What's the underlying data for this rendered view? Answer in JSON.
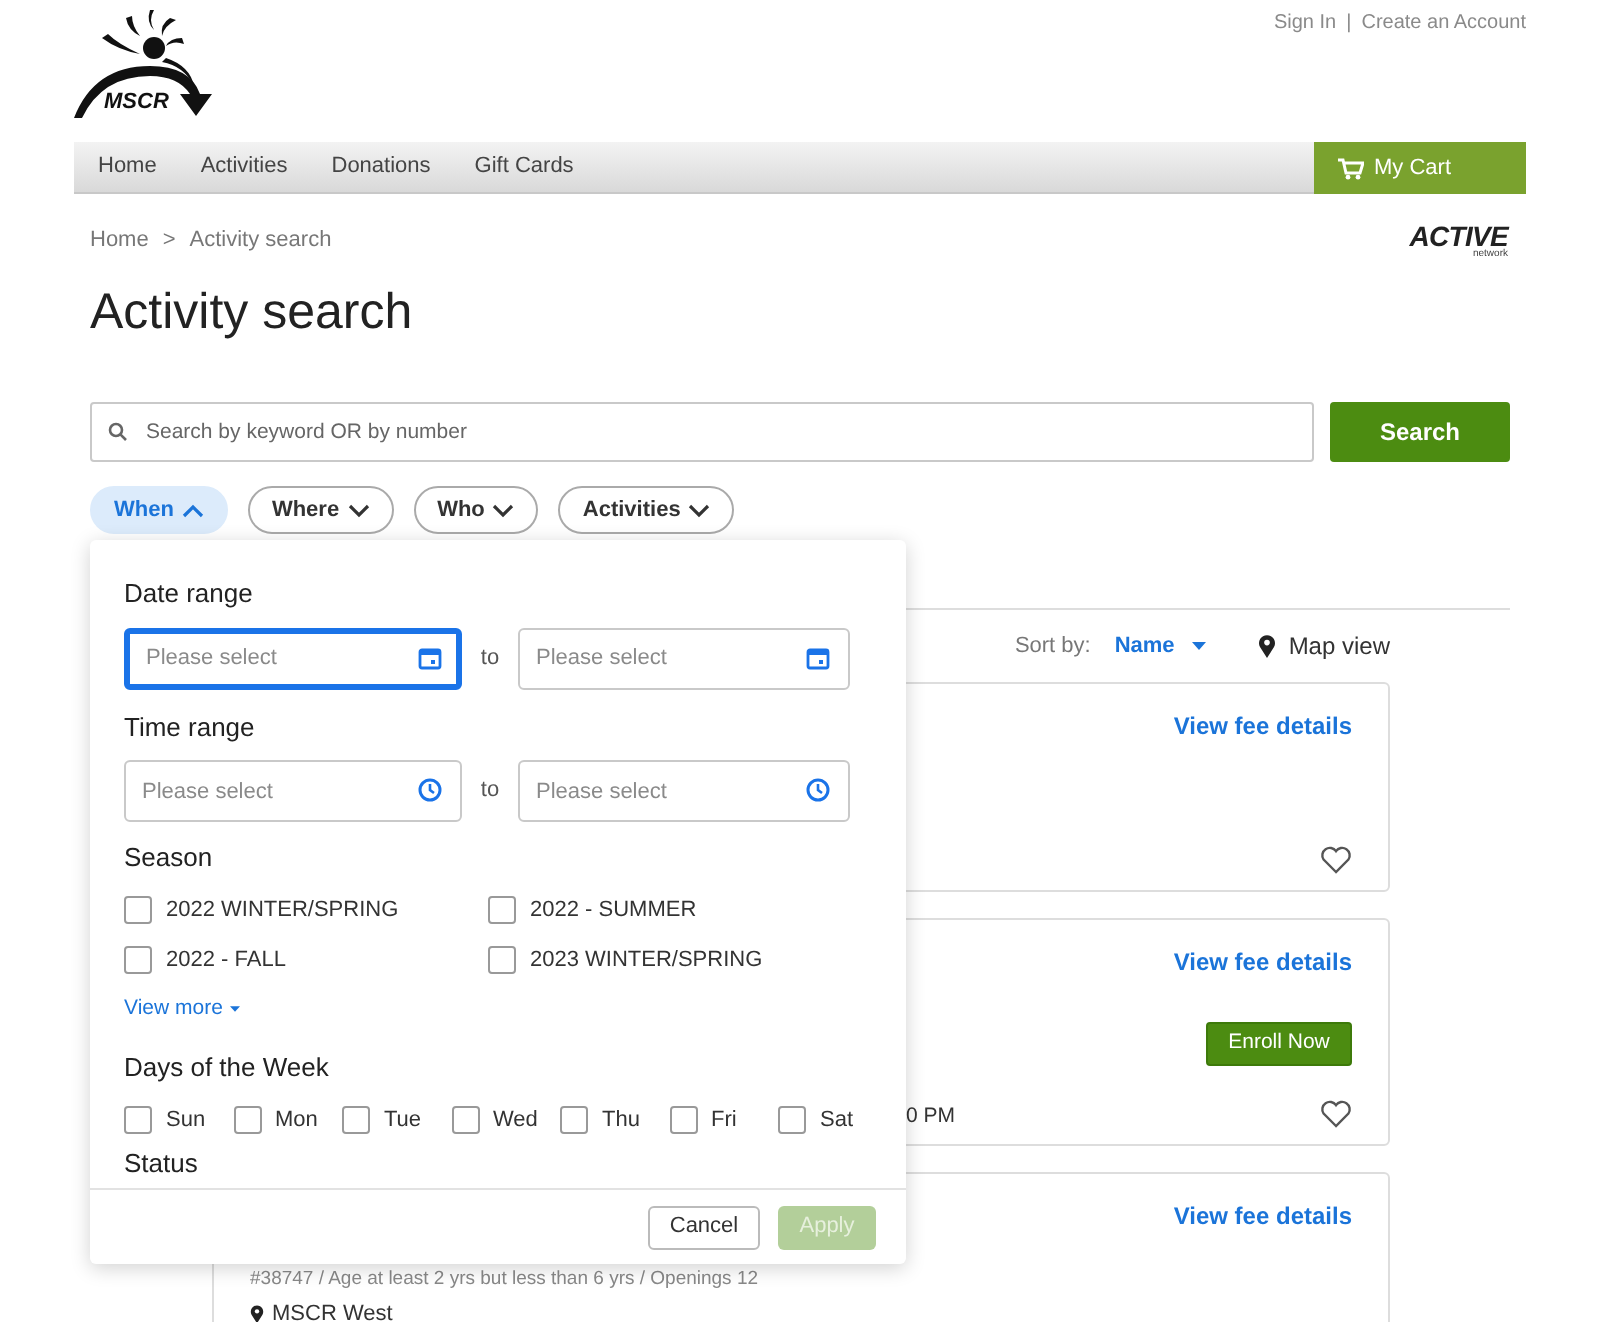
{
  "header": {
    "logo_text": "MSCR",
    "links": [
      "Sign In",
      "Create an Account"
    ],
    "link_separator": "|"
  },
  "nav": {
    "items": [
      "Home",
      "Activities",
      "Donations",
      "Gift Cards"
    ],
    "cart": "My Cart"
  },
  "breadcrumb": {
    "items": [
      "Home",
      "Activity search"
    ],
    "separator": ">"
  },
  "brand": {
    "name": "ACTIVE",
    "sub": "network"
  },
  "title": "Activity search",
  "search": {
    "placeholder": "Search by keyword OR by number",
    "button": "Search"
  },
  "filters": [
    {
      "label": "When",
      "expanded": true
    },
    {
      "label": "Where",
      "expanded": false
    },
    {
      "label": "Who",
      "expanded": false
    },
    {
      "label": "Activities",
      "expanded": false
    }
  ],
  "panel": {
    "date_range": {
      "label": "Date range",
      "from": {
        "placeholder": "Please select",
        "focused": true
      },
      "separator": "to",
      "to": {
        "placeholder": "Please select",
        "focused": false
      }
    },
    "time_range": {
      "label": "Time range",
      "from": {
        "placeholder": "Please select",
        "focused": false
      },
      "separator": "to",
      "to": {
        "placeholder": "Please select",
        "focused": false
      }
    },
    "season": {
      "label": "Season",
      "options": [
        {
          "label": "2022 WINTER/SPRING",
          "checked": false
        },
        {
          "label": "2022 - SUMMER",
          "checked": false
        },
        {
          "label": "2022 - FALL",
          "checked": false
        },
        {
          "label": "2023 WINTER/SPRING",
          "checked": false
        }
      ],
      "view_more": "View more"
    },
    "days": {
      "label": "Days of the Week",
      "options": [
        {
          "label": "Sun",
          "checked": false
        },
        {
          "label": "Mon",
          "checked": false
        },
        {
          "label": "Tue",
          "checked": false
        },
        {
          "label": "Wed",
          "checked": false
        },
        {
          "label": "Thu",
          "checked": false
        },
        {
          "label": "Fri",
          "checked": false
        },
        {
          "label": "Sat",
          "checked": false
        }
      ]
    },
    "status_label": "Status",
    "cancel": "Cancel",
    "apply": {
      "label": "Apply",
      "disabled": true
    }
  },
  "results": {
    "sort_label": "Sort by:",
    "sort_value": "Name",
    "map_view": "Map view",
    "cards": [
      {
        "fee_link": "View fee details",
        "favorited": false
      },
      {
        "fee_link": "View fee details",
        "enroll": "Enroll Now",
        "time": "0 PM",
        "favorited": false
      },
      {
        "fee_link": "View fee details",
        "meta": "#38747 / Age at least 2 yrs but less than 6 yrs / Openings 12",
        "location": "MSCR West"
      }
    ]
  }
}
